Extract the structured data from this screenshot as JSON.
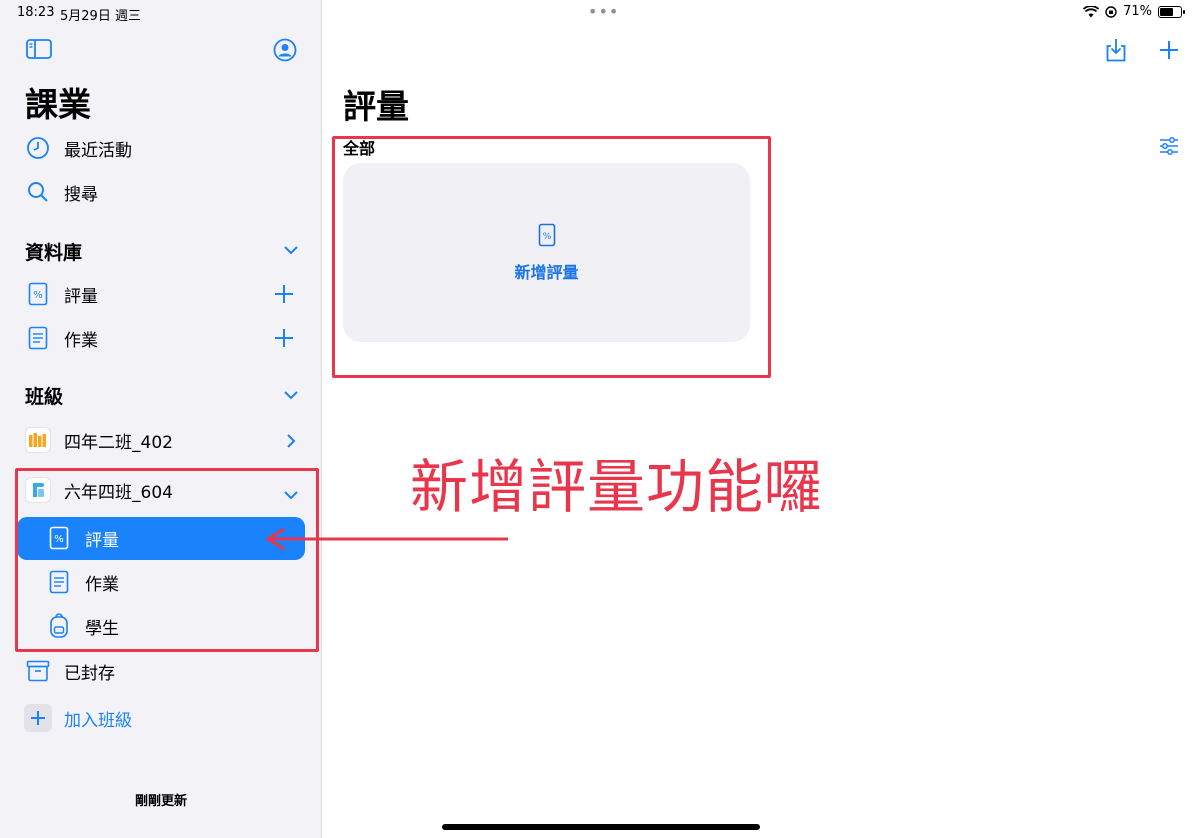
{
  "status": {
    "time": "18:23",
    "date": "5月29日 週三",
    "battery": "71%",
    "battery_level": 0.71
  },
  "sidebar": {
    "title": "課業",
    "recent": "最近活動",
    "search": "搜尋",
    "library_header": "資料庫",
    "library_items": [
      {
        "label": "評量"
      },
      {
        "label": "作業"
      }
    ],
    "classes_header": "班級",
    "class_1": "四年二班_402",
    "class_2": "六年四班_604",
    "sub_items": [
      {
        "label": "評量"
      },
      {
        "label": "作業"
      },
      {
        "label": "學生"
      }
    ],
    "archived": "已封存",
    "join_class": "加入班級",
    "updated": "剛剛更新"
  },
  "main": {
    "title": "評量",
    "section": "全部",
    "card_label": "新增評量"
  },
  "annotation": {
    "text": "新增評量功能囉"
  },
  "colors": {
    "accent": "#1a82fb",
    "annotation": "#e8364c",
    "sidebar_bg": "#f2f2f7",
    "card_bg": "#f0f0f5"
  }
}
